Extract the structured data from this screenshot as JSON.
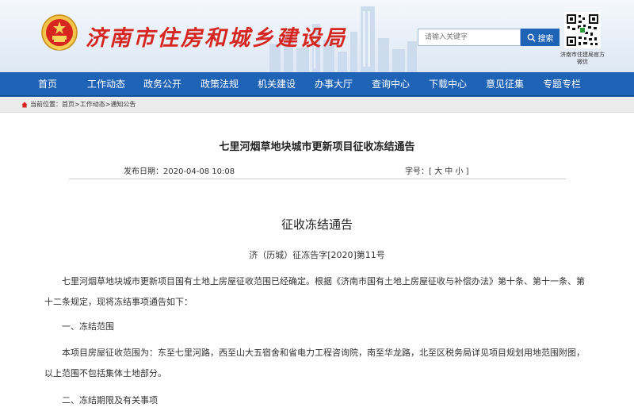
{
  "header": {
    "site_title": "济南市住房和城乡建设局",
    "search": {
      "placeholder": "请输入关键字",
      "button_label": "搜索"
    },
    "qr_caption": "济南市住建局官方微信"
  },
  "nav": {
    "items": [
      {
        "label": "首页"
      },
      {
        "label": "工作动态"
      },
      {
        "label": "政务公开"
      },
      {
        "label": "政策法规"
      },
      {
        "label": "机关建设"
      },
      {
        "label": "办事大厅"
      },
      {
        "label": "查询中心"
      },
      {
        "label": "下载中心"
      },
      {
        "label": "意见征集"
      },
      {
        "label": "专题专栏"
      }
    ]
  },
  "breadcrumb": {
    "prefix": "当前位置：",
    "items": [
      "首页",
      "工作动态",
      "通知公告"
    ],
    "separator": ">"
  },
  "article": {
    "title": "七里河烟草地块城市更新项目征收冻结通告",
    "publish_label": "发布日期：",
    "publish_date": "2020-04-08 10:08",
    "font_size_label": "字号：",
    "font_size_open": "[",
    "font_size_options": [
      "大",
      "中",
      "小"
    ],
    "font_size_close": "]",
    "doc_heading": "征收冻结通告",
    "doc_number": "济（历城）征冻告字[2020]第11号",
    "paragraphs": [
      "七里河烟草地块城市更新项目国有土地上房屋征收范围已经确定。根据《济南市国有土地上房屋征收与补偿办法》第十条、第十一条、第十二条规定，现将冻结事项通告如下：",
      "一、冻结范围",
      "本项目房屋征收范围为：东至七里河路，西至山大五宿舍和省电力工程咨询院，南至华龙路，北至区税务局详见项目规划用地范围附图，以上范围不包括集体土地部分。",
      "二、冻结期限及有关事项"
    ]
  },
  "colors": {
    "nav_blue": "#1f63b6",
    "title_red": "#d7261f",
    "breadcrumb_bg": "#ececec"
  }
}
